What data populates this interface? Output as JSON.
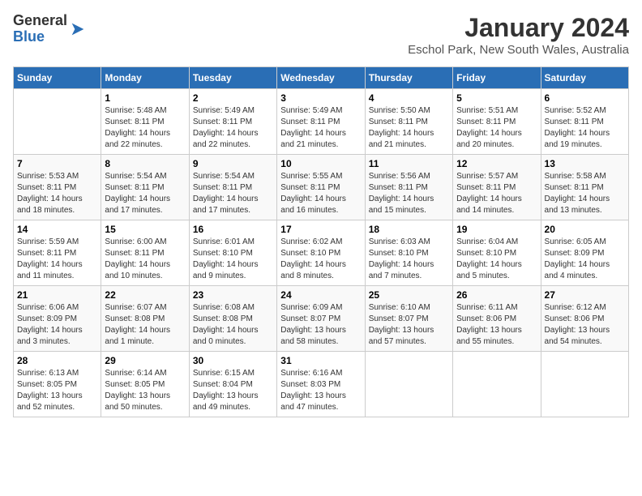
{
  "logo": {
    "general": "General",
    "blue": "Blue"
  },
  "title": "January 2024",
  "subtitle": "Eschol Park, New South Wales, Australia",
  "days_header": [
    "Sunday",
    "Monday",
    "Tuesday",
    "Wednesday",
    "Thursday",
    "Friday",
    "Saturday"
  ],
  "weeks": [
    [
      {
        "day": "",
        "info": ""
      },
      {
        "day": "1",
        "info": "Sunrise: 5:48 AM\nSunset: 8:11 PM\nDaylight: 14 hours\nand 22 minutes."
      },
      {
        "day": "2",
        "info": "Sunrise: 5:49 AM\nSunset: 8:11 PM\nDaylight: 14 hours\nand 22 minutes."
      },
      {
        "day": "3",
        "info": "Sunrise: 5:49 AM\nSunset: 8:11 PM\nDaylight: 14 hours\nand 21 minutes."
      },
      {
        "day": "4",
        "info": "Sunrise: 5:50 AM\nSunset: 8:11 PM\nDaylight: 14 hours\nand 21 minutes."
      },
      {
        "day": "5",
        "info": "Sunrise: 5:51 AM\nSunset: 8:11 PM\nDaylight: 14 hours\nand 20 minutes."
      },
      {
        "day": "6",
        "info": "Sunrise: 5:52 AM\nSunset: 8:11 PM\nDaylight: 14 hours\nand 19 minutes."
      }
    ],
    [
      {
        "day": "7",
        "info": "Sunrise: 5:53 AM\nSunset: 8:11 PM\nDaylight: 14 hours\nand 18 minutes."
      },
      {
        "day": "8",
        "info": "Sunrise: 5:54 AM\nSunset: 8:11 PM\nDaylight: 14 hours\nand 17 minutes."
      },
      {
        "day": "9",
        "info": "Sunrise: 5:54 AM\nSunset: 8:11 PM\nDaylight: 14 hours\nand 17 minutes."
      },
      {
        "day": "10",
        "info": "Sunrise: 5:55 AM\nSunset: 8:11 PM\nDaylight: 14 hours\nand 16 minutes."
      },
      {
        "day": "11",
        "info": "Sunrise: 5:56 AM\nSunset: 8:11 PM\nDaylight: 14 hours\nand 15 minutes."
      },
      {
        "day": "12",
        "info": "Sunrise: 5:57 AM\nSunset: 8:11 PM\nDaylight: 14 hours\nand 14 minutes."
      },
      {
        "day": "13",
        "info": "Sunrise: 5:58 AM\nSunset: 8:11 PM\nDaylight: 14 hours\nand 13 minutes."
      }
    ],
    [
      {
        "day": "14",
        "info": "Sunrise: 5:59 AM\nSunset: 8:11 PM\nDaylight: 14 hours\nand 11 minutes."
      },
      {
        "day": "15",
        "info": "Sunrise: 6:00 AM\nSunset: 8:11 PM\nDaylight: 14 hours\nand 10 minutes."
      },
      {
        "day": "16",
        "info": "Sunrise: 6:01 AM\nSunset: 8:10 PM\nDaylight: 14 hours\nand 9 minutes."
      },
      {
        "day": "17",
        "info": "Sunrise: 6:02 AM\nSunset: 8:10 PM\nDaylight: 14 hours\nand 8 minutes."
      },
      {
        "day": "18",
        "info": "Sunrise: 6:03 AM\nSunset: 8:10 PM\nDaylight: 14 hours\nand 7 minutes."
      },
      {
        "day": "19",
        "info": "Sunrise: 6:04 AM\nSunset: 8:10 PM\nDaylight: 14 hours\nand 5 minutes."
      },
      {
        "day": "20",
        "info": "Sunrise: 6:05 AM\nSunset: 8:09 PM\nDaylight: 14 hours\nand 4 minutes."
      }
    ],
    [
      {
        "day": "21",
        "info": "Sunrise: 6:06 AM\nSunset: 8:09 PM\nDaylight: 14 hours\nand 3 minutes."
      },
      {
        "day": "22",
        "info": "Sunrise: 6:07 AM\nSunset: 8:08 PM\nDaylight: 14 hours\nand 1 minute."
      },
      {
        "day": "23",
        "info": "Sunrise: 6:08 AM\nSunset: 8:08 PM\nDaylight: 14 hours\nand 0 minutes."
      },
      {
        "day": "24",
        "info": "Sunrise: 6:09 AM\nSunset: 8:07 PM\nDaylight: 13 hours\nand 58 minutes."
      },
      {
        "day": "25",
        "info": "Sunrise: 6:10 AM\nSunset: 8:07 PM\nDaylight: 13 hours\nand 57 minutes."
      },
      {
        "day": "26",
        "info": "Sunrise: 6:11 AM\nSunset: 8:06 PM\nDaylight: 13 hours\nand 55 minutes."
      },
      {
        "day": "27",
        "info": "Sunrise: 6:12 AM\nSunset: 8:06 PM\nDaylight: 13 hours\nand 54 minutes."
      }
    ],
    [
      {
        "day": "28",
        "info": "Sunrise: 6:13 AM\nSunset: 8:05 PM\nDaylight: 13 hours\nand 52 minutes."
      },
      {
        "day": "29",
        "info": "Sunrise: 6:14 AM\nSunset: 8:05 PM\nDaylight: 13 hours\nand 50 minutes."
      },
      {
        "day": "30",
        "info": "Sunrise: 6:15 AM\nSunset: 8:04 PM\nDaylight: 13 hours\nand 49 minutes."
      },
      {
        "day": "31",
        "info": "Sunrise: 6:16 AM\nSunset: 8:03 PM\nDaylight: 13 hours\nand 47 minutes."
      },
      {
        "day": "",
        "info": ""
      },
      {
        "day": "",
        "info": ""
      },
      {
        "day": "",
        "info": ""
      }
    ]
  ]
}
